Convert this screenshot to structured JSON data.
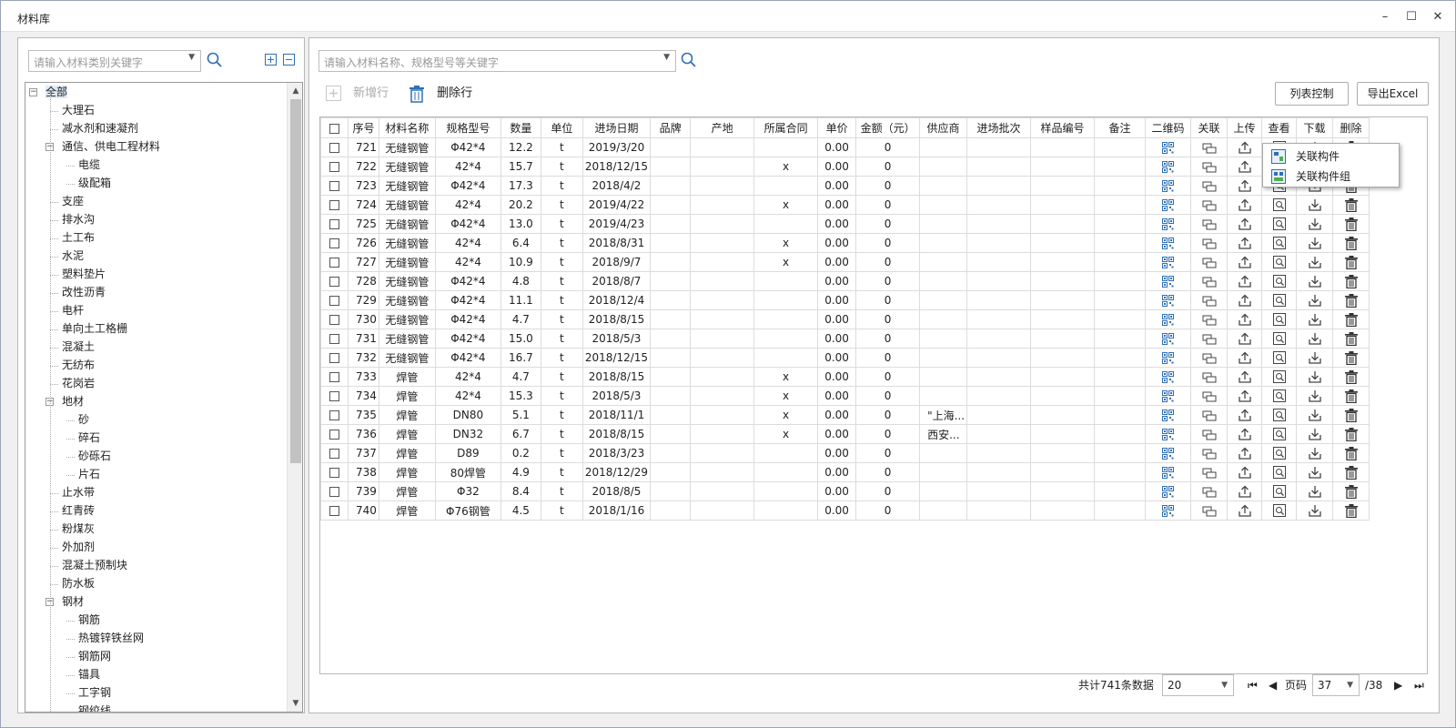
{
  "window": {
    "title": "材料库",
    "minimize": "–",
    "maximize": "☐",
    "close": "✕"
  },
  "sidebar": {
    "search_placeholder": "请输入材料类别关键字",
    "tree": [
      {
        "label": "全部",
        "level": 0,
        "toggle": "−",
        "selected": true
      },
      {
        "label": "大理石",
        "level": 1
      },
      {
        "label": "减水剂和速凝剂",
        "level": 1
      },
      {
        "label": "通信、供电工程材料",
        "level": 1,
        "toggle": "−"
      },
      {
        "label": "电缆",
        "level": 2
      },
      {
        "label": "级配箱",
        "level": 2
      },
      {
        "label": "支座",
        "level": 1
      },
      {
        "label": "排水沟",
        "level": 1
      },
      {
        "label": "土工布",
        "level": 1
      },
      {
        "label": "水泥",
        "level": 1
      },
      {
        "label": "塑料垫片",
        "level": 1
      },
      {
        "label": "改性沥青",
        "level": 1
      },
      {
        "label": "电杆",
        "level": 1
      },
      {
        "label": "单向土工格栅",
        "level": 1
      },
      {
        "label": "混凝土",
        "level": 1
      },
      {
        "label": "无纺布",
        "level": 1
      },
      {
        "label": "花岗岩",
        "level": 1
      },
      {
        "label": "地材",
        "level": 1,
        "toggle": "−"
      },
      {
        "label": "砂",
        "level": 2
      },
      {
        "label": "碎石",
        "level": 2
      },
      {
        "label": "砂砾石",
        "level": 2
      },
      {
        "label": "片石",
        "level": 2
      },
      {
        "label": "止水带",
        "level": 1
      },
      {
        "label": "红青砖",
        "level": 1
      },
      {
        "label": "粉煤灰",
        "level": 1
      },
      {
        "label": "外加剂",
        "level": 1
      },
      {
        "label": "混凝土预制块",
        "level": 1
      },
      {
        "label": "防水板",
        "level": 1
      },
      {
        "label": "钢材",
        "level": 1,
        "toggle": "−"
      },
      {
        "label": "钢筋",
        "level": 2
      },
      {
        "label": "热镀锌铁丝网",
        "level": 2
      },
      {
        "label": "钢筋网",
        "level": 2
      },
      {
        "label": "锚具",
        "level": 2
      },
      {
        "label": "工字钢",
        "level": 2
      },
      {
        "label": "钢绞线",
        "level": 2
      }
    ]
  },
  "main": {
    "search_placeholder": "请输入材料名称、规格型号等关键字",
    "toolbar": {
      "add_label": "新增行",
      "delete_label": "删除行",
      "list_control": "列表控制",
      "export": "导出Excel"
    },
    "columns": [
      "序号",
      "材料名称",
      "规格型号",
      "数量",
      "单位",
      "进场日期",
      "品牌",
      "产地",
      "所属合同",
      "单价",
      "金额（元）",
      "供应商",
      "进场批次",
      "样品编号",
      "备注",
      "二维码",
      "关联",
      "上传",
      "查看",
      "下载",
      "删除"
    ],
    "rows": [
      {
        "no": "721",
        "name": "无缝钢管",
        "spec": "Φ42*4",
        "qty": "12.2",
        "unit": "t",
        "date": "2019/3/20",
        "contract": "",
        "price": "0.00",
        "amount": "0",
        "supplier": ""
      },
      {
        "no": "722",
        "name": "无缝钢管",
        "spec": "42*4",
        "qty": "15.7",
        "unit": "t",
        "date": "2018/12/15",
        "contract": "x",
        "price": "0.00",
        "amount": "0",
        "supplier": ""
      },
      {
        "no": "723",
        "name": "无缝钢管",
        "spec": "Φ42*4",
        "qty": "17.3",
        "unit": "t",
        "date": "2018/4/2",
        "contract": "",
        "price": "0.00",
        "amount": "0",
        "supplier": ""
      },
      {
        "no": "724",
        "name": "无缝钢管",
        "spec": "42*4",
        "qty": "20.2",
        "unit": "t",
        "date": "2019/4/22",
        "contract": "x",
        "price": "0.00",
        "amount": "0",
        "supplier": ""
      },
      {
        "no": "725",
        "name": "无缝钢管",
        "spec": "Φ42*4",
        "qty": "13.0",
        "unit": "t",
        "date": "2019/4/23",
        "contract": "",
        "price": "0.00",
        "amount": "0",
        "supplier": ""
      },
      {
        "no": "726",
        "name": "无缝钢管",
        "spec": "42*4",
        "qty": "6.4",
        "unit": "t",
        "date": "2018/8/31",
        "contract": "x",
        "price": "0.00",
        "amount": "0",
        "supplier": ""
      },
      {
        "no": "727",
        "name": "无缝钢管",
        "spec": "42*4",
        "qty": "10.9",
        "unit": "t",
        "date": "2018/9/7",
        "contract": "x",
        "price": "0.00",
        "amount": "0",
        "supplier": ""
      },
      {
        "no": "728",
        "name": "无缝钢管",
        "spec": "Φ42*4",
        "qty": "4.8",
        "unit": "t",
        "date": "2018/8/7",
        "contract": "",
        "price": "0.00",
        "amount": "0",
        "supplier": ""
      },
      {
        "no": "729",
        "name": "无缝钢管",
        "spec": "Φ42*4",
        "qty": "11.1",
        "unit": "t",
        "date": "2018/12/4",
        "contract": "",
        "price": "0.00",
        "amount": "0",
        "supplier": ""
      },
      {
        "no": "730",
        "name": "无缝钢管",
        "spec": "Φ42*4",
        "qty": "4.7",
        "unit": "t",
        "date": "2018/8/15",
        "contract": "",
        "price": "0.00",
        "amount": "0",
        "supplier": ""
      },
      {
        "no": "731",
        "name": "无缝钢管",
        "spec": "Φ42*4",
        "qty": "15.0",
        "unit": "t",
        "date": "2018/5/3",
        "contract": "",
        "price": "0.00",
        "amount": "0",
        "supplier": ""
      },
      {
        "no": "732",
        "name": "无缝钢管",
        "spec": "Φ42*4",
        "qty": "16.7",
        "unit": "t",
        "date": "2018/12/15",
        "contract": "",
        "price": "0.00",
        "amount": "0",
        "supplier": ""
      },
      {
        "no": "733",
        "name": "焊管",
        "spec": "42*4",
        "qty": "4.7",
        "unit": "t",
        "date": "2018/8/15",
        "contract": "x",
        "price": "0.00",
        "amount": "0",
        "supplier": ""
      },
      {
        "no": "734",
        "name": "焊管",
        "spec": "42*4",
        "qty": "15.3",
        "unit": "t",
        "date": "2018/5/3",
        "contract": "x",
        "price": "0.00",
        "amount": "0",
        "supplier": ""
      },
      {
        "no": "735",
        "name": "焊管",
        "spec": "DN80",
        "qty": "5.1",
        "unit": "t",
        "date": "2018/11/1",
        "contract": "x",
        "price": "0.00",
        "amount": "0",
        "supplier": "\"上海..."
      },
      {
        "no": "736",
        "name": "焊管",
        "spec": "DN32",
        "qty": "6.7",
        "unit": "t",
        "date": "2018/8/15",
        "contract": "x",
        "price": "0.00",
        "amount": "0",
        "supplier": "西安..."
      },
      {
        "no": "737",
        "name": "焊管",
        "spec": "D89",
        "qty": "0.2",
        "unit": "t",
        "date": "2018/3/23",
        "contract": "",
        "price": "0.00",
        "amount": "0",
        "supplier": ""
      },
      {
        "no": "738",
        "name": "焊管",
        "spec": "80焊管",
        "qty": "4.9",
        "unit": "t",
        "date": "2018/12/29",
        "contract": "",
        "price": "0.00",
        "amount": "0",
        "supplier": ""
      },
      {
        "no": "739",
        "name": "焊管",
        "spec": "Φ32",
        "qty": "8.4",
        "unit": "t",
        "date": "2018/8/5",
        "contract": "",
        "price": "0.00",
        "amount": "0",
        "supplier": ""
      },
      {
        "no": "740",
        "name": "焊管",
        "spec": "Φ76钢管",
        "qty": "4.5",
        "unit": "t",
        "date": "2018/1/16",
        "contract": "",
        "price": "0.00",
        "amount": "0",
        "supplier": ""
      }
    ],
    "context_menu": [
      "关联构件",
      "关联构件组"
    ],
    "pager": {
      "total": "共计741条数据",
      "page_size": "20",
      "page_label": "页码",
      "page": "37",
      "page_count": "/38"
    }
  },
  "colors": {
    "icon_blue": "#2e6fb5",
    "selection": "#dfe9f7",
    "border": "#b8b8b8"
  }
}
